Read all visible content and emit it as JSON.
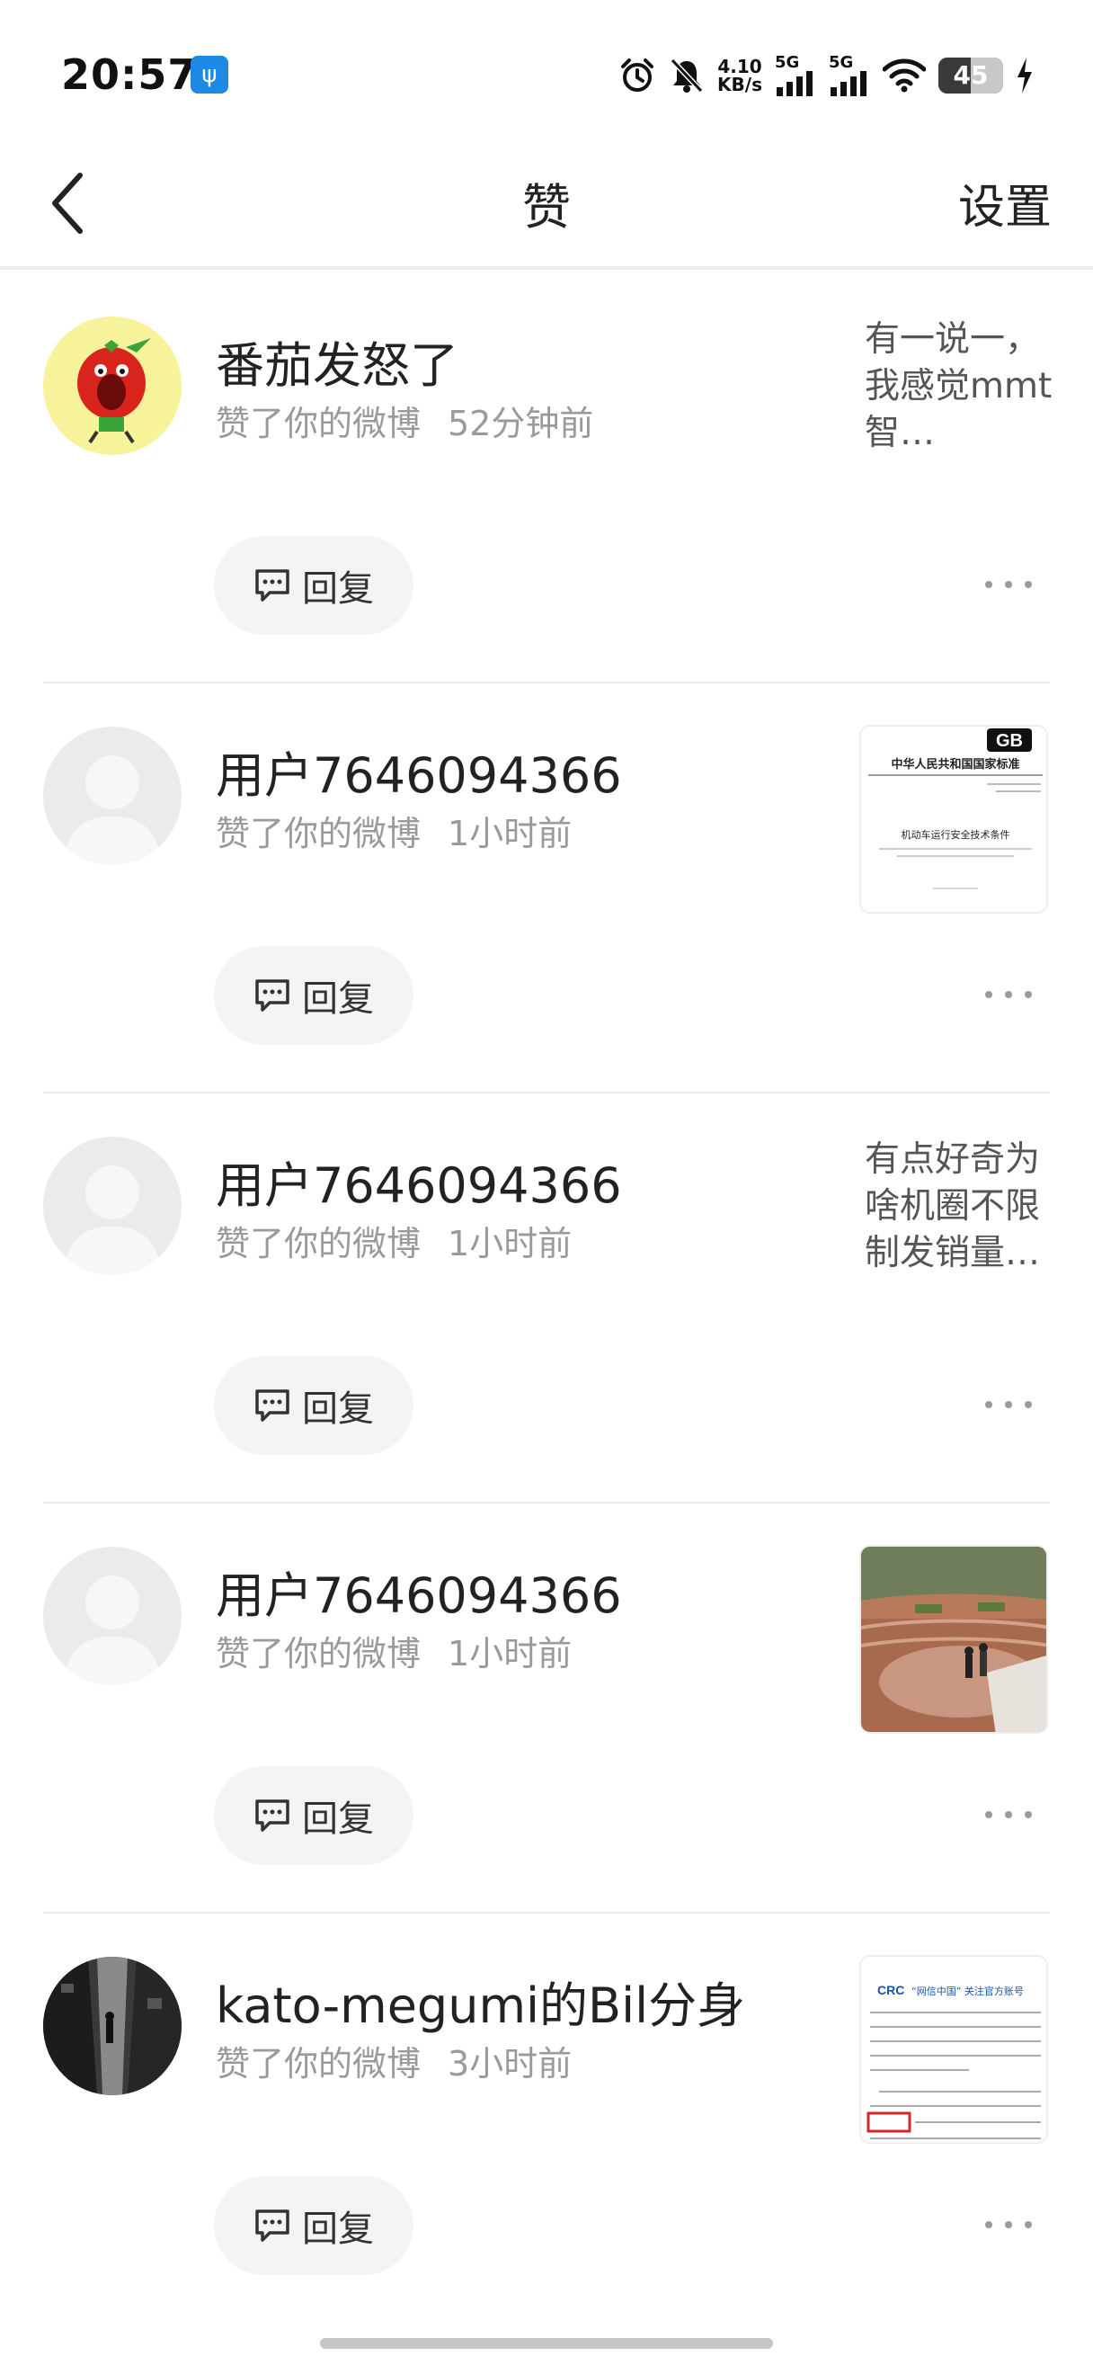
{
  "status_bar": {
    "time": "20:57",
    "usb_icon": "usb-icon",
    "net_speed_value": "4.10",
    "net_speed_unit": "KB/s",
    "sim1_label": "5G",
    "sim2_label": "5G",
    "battery_level": "45",
    "icons": [
      "alarm-icon",
      "bell-off-icon",
      "signal-icon",
      "wifi-icon",
      "battery-icon",
      "charging-icon"
    ]
  },
  "header": {
    "title": "赞",
    "settings_label": "设置",
    "back_icon": "chevron-left-icon"
  },
  "items": [
    {
      "user": "番茄发怒了",
      "action": "赞了你的微博",
      "time": "52分钟前",
      "preview_type": "text",
      "preview_text": "有一说一，我感觉mmt智…",
      "reply_label": "回复"
    },
    {
      "user": "用户7646094366",
      "action": "赞了你的微博",
      "time": "1小时前",
      "preview_type": "image",
      "preview_image": "document-thumbnail",
      "preview_lines": [
        "中华人民共和国国家标准",
        "机动车运行安全技术条件"
      ],
      "preview_badge": "GB",
      "reply_label": "回复"
    },
    {
      "user": "用户7646094366",
      "action": "赞了你的微博",
      "time": "1小时前",
      "preview_type": "text",
      "preview_text": "有点好奇为啥机圈不限制发销量…",
      "reply_label": "回复"
    },
    {
      "user": "用户7646094366",
      "action": "赞了你的微博",
      "time": "1小时前",
      "preview_type": "image",
      "preview_image": "photo-thumbnail",
      "reply_label": "回复"
    },
    {
      "user": "kato-megumi的Bil分身",
      "action": "赞了你的微博",
      "time": "3小时前",
      "preview_type": "image",
      "preview_image": "article-thumbnail",
      "preview_logo": "CRC",
      "preview_lines": [
        "“网信中国” 关注官方账号"
      ],
      "reply_label": "回复"
    }
  ],
  "colors": {
    "background": "#ffffff",
    "text_primary": "#222222",
    "text_secondary": "#9a9a9a",
    "reply_bg": "#f4f4f4",
    "divider": "#ececec"
  }
}
